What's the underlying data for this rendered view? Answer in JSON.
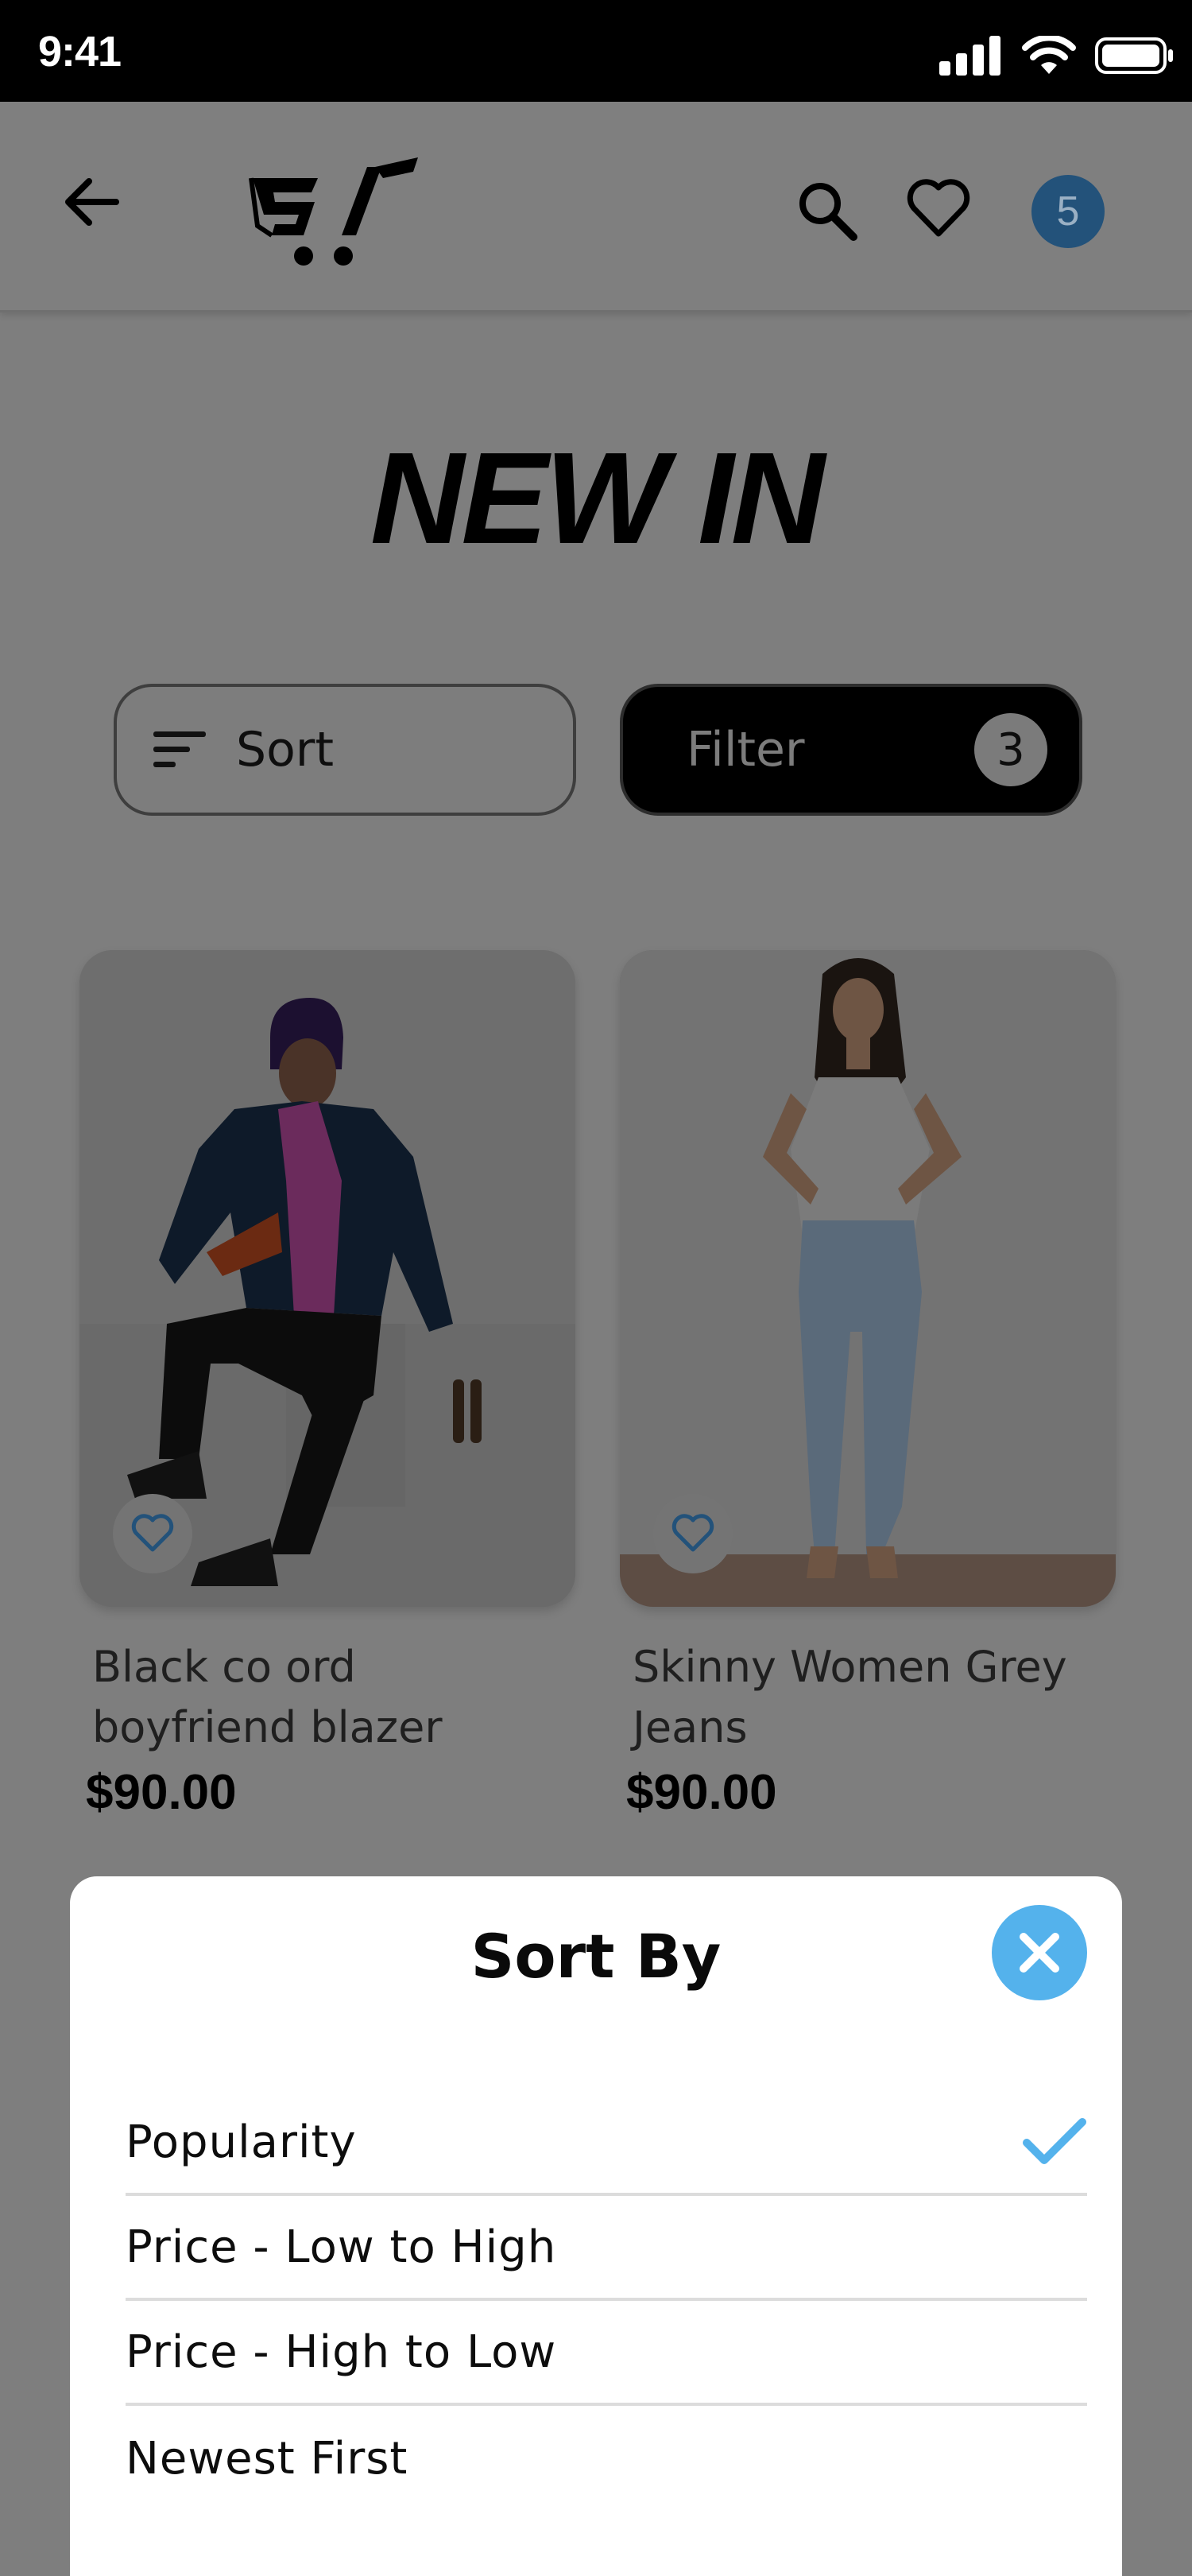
{
  "status_bar": {
    "time": "9:41"
  },
  "header": {
    "cart_count": "5"
  },
  "page": {
    "title": "NEW IN"
  },
  "controls": {
    "sort_label": "Sort",
    "filter_label": "Filter",
    "filter_count": "3"
  },
  "products": [
    {
      "name": "Black co ord boyfriend blazer",
      "price": "$90.00"
    },
    {
      "name": "Skinny Women Grey Jeans",
      "price": "$90.00"
    }
  ],
  "sort_sheet": {
    "title": "Sort By",
    "options": [
      {
        "label": "Popularity",
        "selected": true
      },
      {
        "label": "Price - Low to High",
        "selected": false
      },
      {
        "label": "Price - High to Low",
        "selected": false
      },
      {
        "label": "Newest First",
        "selected": false
      }
    ]
  },
  "colors": {
    "accent": "#54b2ec",
    "badge": "#23527a"
  }
}
